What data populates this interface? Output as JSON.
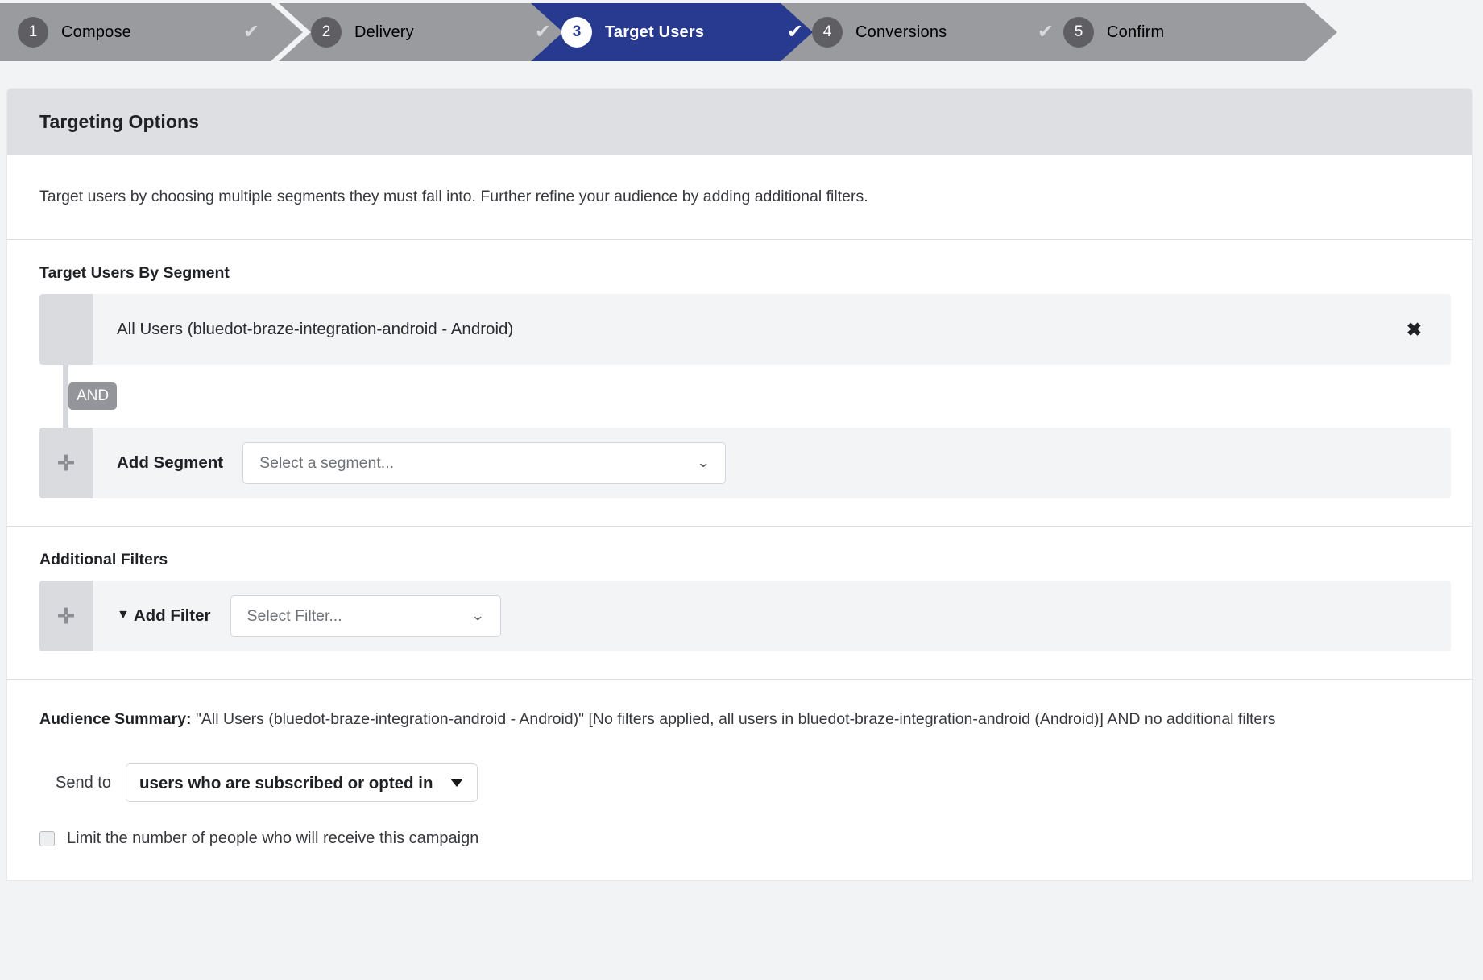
{
  "steps": [
    {
      "num": "1",
      "label": "Compose",
      "check": "✔",
      "active": false
    },
    {
      "num": "2",
      "label": "Delivery",
      "check": "✔",
      "active": false
    },
    {
      "num": "3",
      "label": "Target Users",
      "check": "✔",
      "active": true
    },
    {
      "num": "4",
      "label": "Conversions",
      "check": "✔",
      "active": false
    },
    {
      "num": "5",
      "label": "Confirm",
      "check": "",
      "active": false
    }
  ],
  "panel": {
    "title": "Targeting Options",
    "intro": "Target users by choosing multiple segments they must fall into. Further refine your audience by adding additional filters."
  },
  "segments": {
    "heading": "Target Users By Segment",
    "selected_label": "All Users (bluedot-braze-integration-android - Android)",
    "remove_icon": "✖",
    "and_badge": "AND",
    "add_handle": "✛",
    "add_label": "Add Segment",
    "select_placeholder": "Select a segment...",
    "caret": "⌄"
  },
  "filters": {
    "heading": "Additional Filters",
    "add_handle": "✛",
    "funnel_icon": "▼",
    "add_label": "Add Filter",
    "select_placeholder": "Select Filter...",
    "caret": "⌄"
  },
  "summary": {
    "label": "Audience Summary:",
    "body": " \"All Users (bluedot-braze-integration-android - Android)\" [No filters applied, all users in bluedot-braze-integration-android (Android)] AND no additional filters",
    "send_to_label": "Send to",
    "send_to_value": "users who are subscribed or opted in",
    "send_to_options": [
      "users who are subscribed or opted in"
    ],
    "limit_checkbox_label": "Limit the number of people who will receive this campaign"
  },
  "colors": {
    "active_step": "#283a8f",
    "inactive_step": "#9a9b9f",
    "panel_header": "#dedfe3",
    "row_bg": "#f3f4f6",
    "handle_bg": "#d9dbdf"
  }
}
